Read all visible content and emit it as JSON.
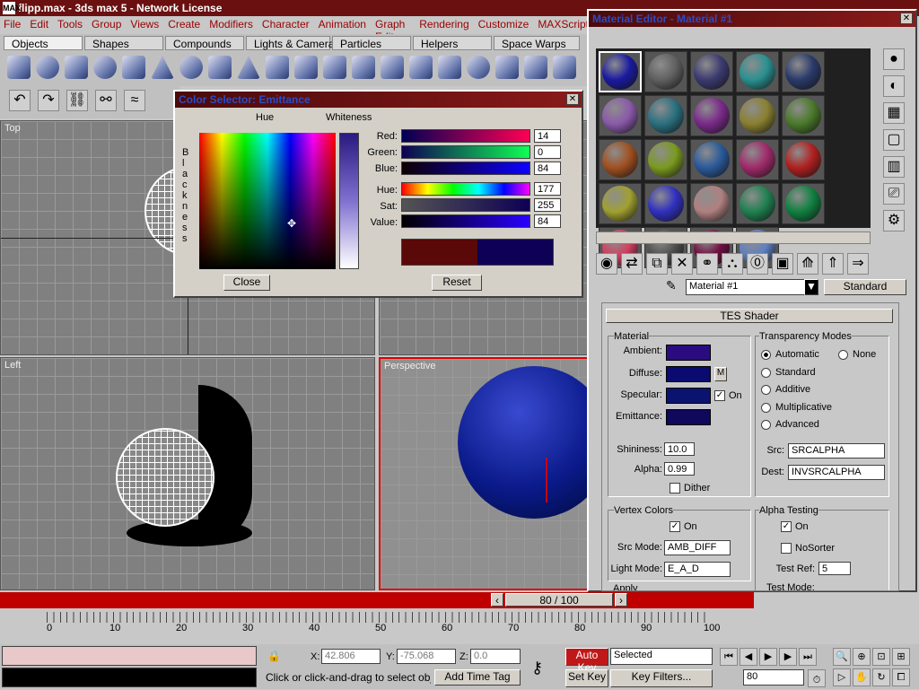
{
  "window": {
    "title": "flipp.max - 3ds max 5 - Network License"
  },
  "menu": [
    "File",
    "Edit",
    "Tools",
    "Group",
    "Views",
    "Create",
    "Modifiers",
    "Character",
    "Animation",
    "Graph Editors",
    "Rendering",
    "Customize",
    "MAXScript"
  ],
  "tabs": [
    "Objects",
    "Shapes",
    "Compounds",
    "Lights & Cameras",
    "Particles",
    "Helpers",
    "Space Warps"
  ],
  "viewports": {
    "top": "Top",
    "left": "Left",
    "perspective": "Perspective"
  },
  "color_selector": {
    "title": "Color Selector: Emittance",
    "hue_label": "Hue",
    "whiteness_label": "Whiteness",
    "blackness_label": "B l a c k n e s s",
    "rows": [
      {
        "label": "Red:",
        "value": "14"
      },
      {
        "label": "Green:",
        "value": "0"
      },
      {
        "label": "Blue:",
        "value": "84"
      },
      {
        "label": "Hue:",
        "value": "177"
      },
      {
        "label": "Sat:",
        "value": "255"
      },
      {
        "label": "Value:",
        "value": "84"
      }
    ],
    "close": "Close",
    "reset": "Reset",
    "old_color": "#5a0808",
    "new_color": "#0e0054"
  },
  "material_editor": {
    "title": "Material Editor - Material #1",
    "slots": [
      "#1a1aa0",
      "#606060",
      "#3c3a70",
      "#2a9090",
      "#2a3a6a",
      "#8a5aaa",
      "#2a7080",
      "#7a2a8a",
      "#8a8030",
      "#4a7a2a",
      "#a05020",
      "#7a9a20",
      "#2a5a9a",
      "#a02a6a",
      "#b02020",
      "#a0a030",
      "#3030c0",
      "#b08080",
      "#208050",
      "#108040",
      "#d04060",
      "#505050",
      "#701040",
      "#6080c0"
    ],
    "material_name": "Material #1",
    "type_button": "Standard",
    "rollout": "TES Shader",
    "material_group": "Material",
    "ambient": "Ambient:",
    "diffuse": "Diffuse:",
    "specular": "Specular:",
    "emittance": "Emittance:",
    "m": "M",
    "on": "On",
    "ambient_color": "#2a0c80",
    "diffuse_color": "#0a0a70",
    "specular_color": "#0a1470",
    "emittance_color": "#10085a",
    "shininess_label": "Shininess:",
    "shininess": "10.0",
    "alpha_label": "Alpha:",
    "alpha": "0.99",
    "dither": "Dither",
    "transparency": {
      "title": "Transparency Modes",
      "automatic": "Automatic",
      "none": "None",
      "standard": "Standard",
      "additive": "Additive",
      "multiplicative": "Multiplicative",
      "advanced": "Advanced",
      "src_label": "Src:",
      "src": "SRCALPHA",
      "dest_label": "Dest:",
      "dest": "INVSRCALPHA"
    },
    "vertex": {
      "title": "Vertex Colors",
      "on": "On",
      "src_mode_label": "Src Mode:",
      "src_mode": "AMB_DIFF",
      "light_mode_label": "Light Mode:",
      "light_mode": "E_A_D"
    },
    "alpha_testing": {
      "title": "Alpha Testing",
      "on": "On",
      "nosorter": "NoSorter",
      "test_ref_label": "Test Ref:",
      "test_ref": "5",
      "test_mode_label": "Test Mode:"
    },
    "apply": "Apply"
  },
  "timeline": {
    "frame": "80 / 100",
    "ticks": [
      "0",
      "10",
      "20",
      "30",
      "40",
      "50",
      "60",
      "70",
      "80",
      "90",
      "100"
    ]
  },
  "status": {
    "x_label": "X:",
    "x": "42.806",
    "y_label": "Y:",
    "y": "-75.068",
    "z_label": "Z:",
    "z": "0.0",
    "autokey": "Auto Key",
    "selected": "Selected",
    "setkey": "Set Key",
    "keyfilters": "Key Filters...",
    "frame": "80",
    "prompt": "Click or click-and-drag to select objec",
    "add_time_tag": "Add Time Tag"
  }
}
